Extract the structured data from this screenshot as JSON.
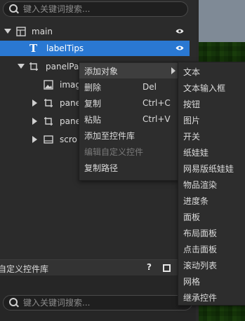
{
  "hierarchy": {
    "search_placeholder": "键入关键词搜索...",
    "nodes": {
      "main": "main",
      "labelTips": "labelTips",
      "panelPanel": "panelPa",
      "image": "imag",
      "panel1": "pane",
      "panel2": "pane",
      "scroll": "scro"
    }
  },
  "context_menu": {
    "items": [
      {
        "label": "添加对象",
        "shortcut": ""
      },
      {
        "label": "删除",
        "shortcut": "Del"
      },
      {
        "label": "复制",
        "shortcut": "Ctrl+C"
      },
      {
        "label": "粘贴",
        "shortcut": "Ctrl+V"
      },
      {
        "label": "添加至控件库",
        "shortcut": ""
      },
      {
        "label": "编辑自定义控件",
        "shortcut": ""
      },
      {
        "label": "复制路径",
        "shortcut": ""
      }
    ]
  },
  "submenu": {
    "items": [
      "文本",
      "文本输入框",
      "按钮",
      "图片",
      "开关",
      "纸娃娃",
      "网易版纸娃娃",
      "物品渲染",
      "进度条",
      "面板",
      "布局面板",
      "点击面板",
      "滚动列表",
      "网格",
      "继承控件"
    ]
  },
  "library": {
    "title": "自定义控件库",
    "help": "?",
    "search_placeholder": "键入关键词搜索..."
  },
  "colors": {
    "selection": "#2a78d2",
    "panel_bg": "#2b2b2b",
    "menu_bg": "#2d2d2d",
    "menu_hover": "#3e3e3e"
  }
}
